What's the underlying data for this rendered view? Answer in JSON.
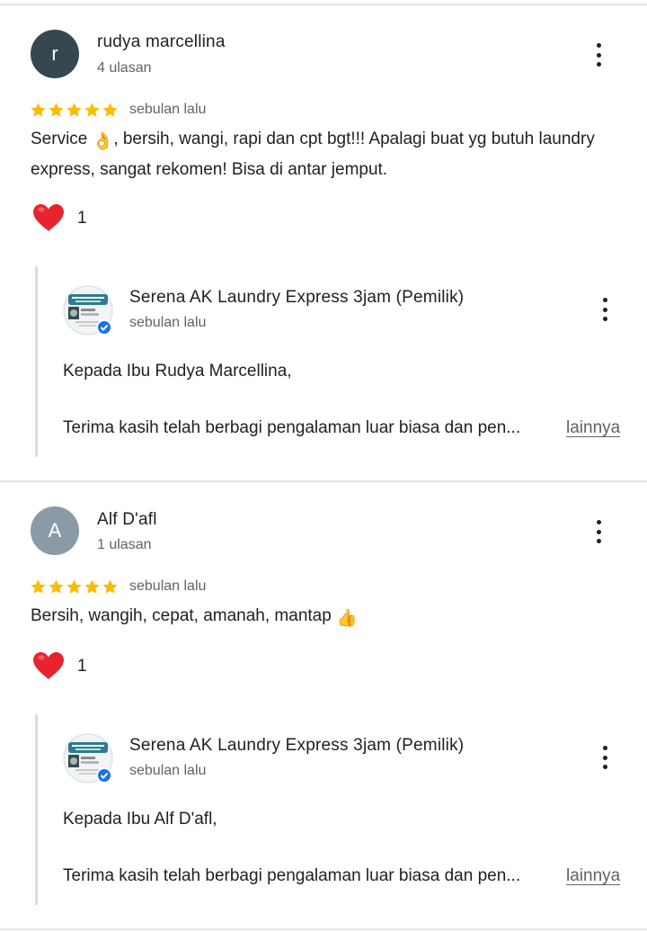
{
  "colors": {
    "star": "#fbbc04",
    "heart": "#e8232b",
    "verified": "#1a73e8",
    "avatar_r": "#37474f",
    "avatar_a": "#8a9aa6"
  },
  "reviews": [
    {
      "avatar_letter": "r",
      "name": "rudya marcellina",
      "count": "4 ulasan",
      "rating": 5,
      "date": "sebulan lalu",
      "text_a": "Service ",
      "emoji": "👌",
      "text_b": ", bersih, wangi, rapi dan cpt bgt!!! Apalagi buat yg butuh laundry express, sangat rekomen! Bisa di antar jemput.",
      "likes": "1",
      "reply": {
        "owner": "Serena AK Laundry Express 3jam (Pemilik)",
        "date": "sebulan lalu",
        "greeting": "Kepada Ibu Rudya Marcellina,",
        "excerpt": "Terima kasih telah berbagi pengalaman luar biasa dan pen...",
        "more": "lainnya"
      }
    },
    {
      "avatar_letter": "A",
      "name": "Alf D'afl",
      "count": "1 ulasan",
      "rating": 5,
      "date": "sebulan lalu",
      "text_a": "Bersih, wangih, cepat, amanah, mantap ",
      "emoji": "👍",
      "text_b": "",
      "likes": "1",
      "reply": {
        "owner": "Serena AK Laundry Express 3jam (Pemilik)",
        "date": "sebulan lalu",
        "greeting": "Kepada Ibu Alf D'afl,",
        "excerpt": "Terima kasih telah berbagi pengalaman luar biasa dan pen...",
        "more": "lainnya"
      }
    }
  ]
}
